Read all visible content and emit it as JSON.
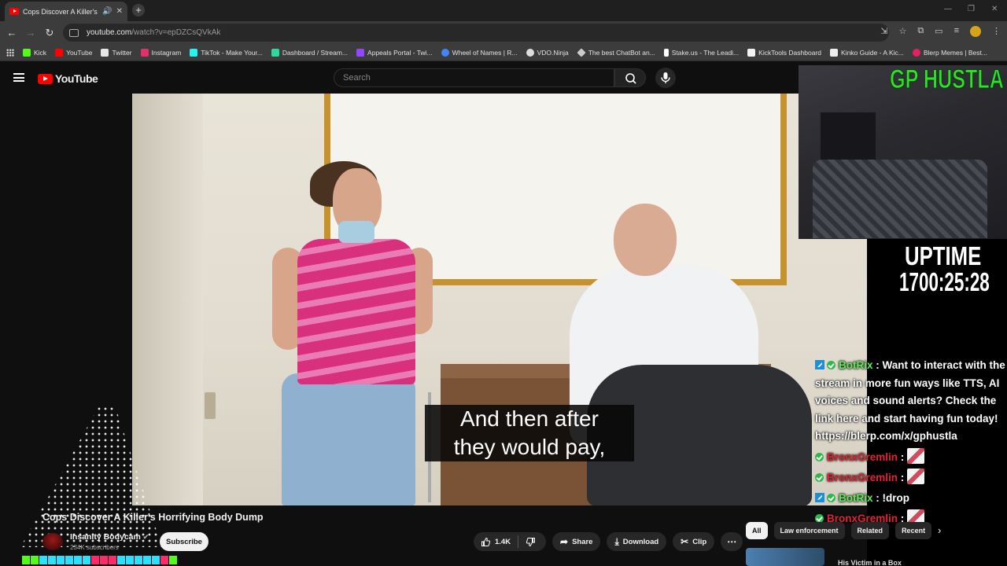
{
  "browser": {
    "tab_title": "Cops Discover A Killer's Horrifying Body Dump",
    "url_host": "youtube.com",
    "url_path": "/watch?v=epDZCsQVkAk",
    "bookmarks": [
      {
        "label": "Kick",
        "color": "#53fc18"
      },
      {
        "label": "YouTube",
        "color": "#ff0000"
      },
      {
        "label": "Twitter",
        "color": "#e7e7e7"
      },
      {
        "label": "Instagram",
        "color": "#e1306c"
      },
      {
        "label": "TikTok - Make Your...",
        "color": "#25f4ee"
      },
      {
        "label": "Dashboard / Stream...",
        "color": "#2fd7a0"
      },
      {
        "label": "Appeals Portal - Twi...",
        "color": "#9146ff"
      },
      {
        "label": "Wheel of Names | R...",
        "color": "#4285f4"
      },
      {
        "label": "VDO.Ninja",
        "color": "#dddddd"
      },
      {
        "label": "The best ChatBot an...",
        "color": "#cccccc"
      },
      {
        "label": "Stake.us - The Leadi...",
        "color": "#ffffff"
      },
      {
        "label": "KickTools Dashboard",
        "color": "#f2f2f2"
      },
      {
        "label": "Kinko Guide - A Kic...",
        "color": "#eeeeee"
      },
      {
        "label": "Blerp Memes | Best...",
        "color": "#e91e63"
      }
    ]
  },
  "youtube": {
    "logo_text": "YouTube",
    "search_placeholder": "Search",
    "video_title": "Cops Discover A Killer's Horrifying Body Dump",
    "channel_name": "Insanity Bodycam",
    "channel_subs": "234K subscribers",
    "subscribe_label": "Subscribe",
    "like_count": "1.4K",
    "share_label": "Share",
    "download_label": "Download",
    "clip_label": "Clip",
    "chips": [
      "All",
      "Law enforcement",
      "Related",
      "Recent"
    ],
    "related_title": "His Victim in a Box"
  },
  "caption": {
    "line1": "And then after",
    "line2": "they would pay,"
  },
  "stream_overlay": {
    "cam_name": "GP HUSTLA",
    "uptime_label": "UPTIME",
    "uptime_value": "1700:25:28",
    "chat": [
      {
        "user": "BotRix",
        "bot": true,
        "message": "Want to interact with the stream in more fun ways like TTS, AI voices and sound alerts? Check the link here and start having fun today! https://blerp.com/x/gphustla"
      },
      {
        "user": "BronxGremlin",
        "bot": false,
        "message": ""
      },
      {
        "user": "BronxGremlin",
        "bot": false,
        "message": ""
      },
      {
        "user": "BotRix",
        "bot": true,
        "message": "!drop"
      },
      {
        "user": "BronxGremlin",
        "bot": false,
        "message": ""
      }
    ]
  }
}
